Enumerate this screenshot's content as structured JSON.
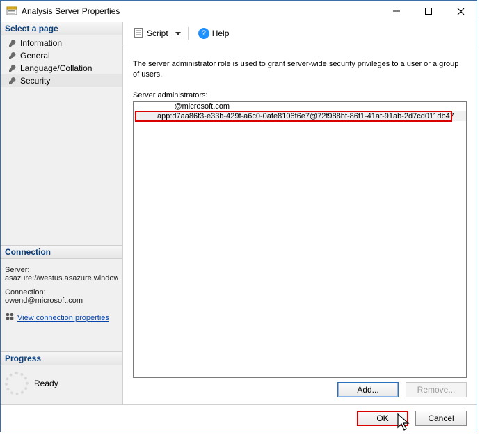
{
  "window": {
    "title": "Analysis Server Properties"
  },
  "sidebar": {
    "select_page_header": "Select a page",
    "pages": [
      {
        "label": "Information"
      },
      {
        "label": "General"
      },
      {
        "label": "Language/Collation"
      },
      {
        "label": "Security"
      }
    ],
    "connection_header": "Connection",
    "server_label": "Server:",
    "server_value": "asazure://westus.asazure.windows",
    "connection_label": "Connection:",
    "connection_value": "owend@microsoft.com",
    "view_props_link": "View connection properties",
    "progress_header": "Progress",
    "progress_status": "Ready"
  },
  "toolbar": {
    "script_label": "Script",
    "help_label": "Help"
  },
  "content": {
    "description": "The server administrator role is used to grant server-wide security privileges to a user or a group of users.",
    "list_label": "Server administrators:",
    "admins": [
      "        @microsoft.com",
      "app:d7aa86f3-e33b-429f-a6c0-0afe8106f6e7@72f988bf-86f1-41af-91ab-2d7cd011db47"
    ],
    "add_label": "Add...",
    "remove_label": "Remove..."
  },
  "footer": {
    "ok_label": "OK",
    "cancel_label": "Cancel"
  }
}
